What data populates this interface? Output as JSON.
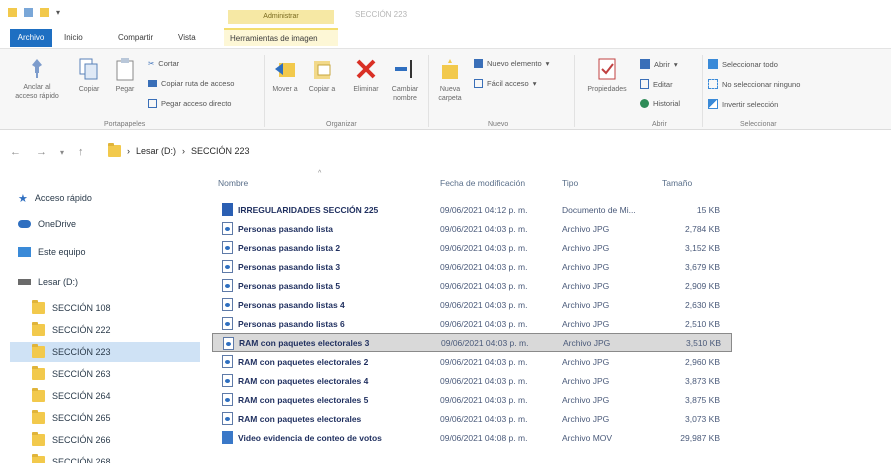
{
  "window": {
    "context_header": "Administrar",
    "title": "SECCIÓN 223"
  },
  "tabs": [
    {
      "label": "Archivo"
    },
    {
      "label": "Inicio"
    },
    {
      "label": "Compartir"
    },
    {
      "label": "Vista"
    },
    {
      "label": "Herramientas de imagen"
    }
  ],
  "ribbon": {
    "portapapeles": {
      "anclar": "Anclar al acceso rápido",
      "copiar": "Copiar",
      "pegar": "Pegar",
      "cortar": "Cortar",
      "copiar_ruta": "Copiar ruta de acceso",
      "pegar_acceso": "Pegar acceso directo",
      "label": "Portapapeles"
    },
    "organizar": {
      "mover": "Mover a",
      "copiar": "Copiar a",
      "eliminar": "Eliminar",
      "cambiar": "Cambiar nombre",
      "label": "Organizar"
    },
    "nuevo": {
      "carpeta": "Nueva carpeta",
      "elemento": "Nuevo elemento",
      "facil": "Fácil acceso",
      "label": "Nuevo"
    },
    "abrir": {
      "propiedades": "Propiedades",
      "abrir": "Abrir",
      "editar": "Editar",
      "historial": "Historial",
      "label": "Abrir"
    },
    "seleccionar": {
      "todo": "Seleccionar todo",
      "ninguno": "No seleccionar ninguno",
      "invertir": "Invertir selección",
      "label": "Seleccionar"
    }
  },
  "address": {
    "drive": "Lesar (D:)",
    "folder": "SECCIÓN 223"
  },
  "sidebar": {
    "quick_access": "Acceso rápido",
    "onedrive": "OneDrive",
    "this_pc": "Este equipo",
    "drive": "Lesar (D:)",
    "folders": [
      "SECCIÓN 108",
      "SECCIÓN 222",
      "SECCIÓN 223",
      "SECCIÓN 263",
      "SECCIÓN 264",
      "SECCIÓN 265",
      "SECCIÓN 266",
      "SECCIÓN 268"
    ],
    "selected_index": 2
  },
  "columns": {
    "name": "Nombre",
    "date": "Fecha de modificación",
    "type": "Tipo",
    "size": "Tamaño"
  },
  "files": [
    {
      "name": "IRREGULARIDADES SECCIÓN 225",
      "date": "09/06/2021 04:12 p. m.",
      "type": "Documento de Mi...",
      "size": "15 KB",
      "icon": "doc"
    },
    {
      "name": "Personas pasando lista",
      "date": "09/06/2021 04:03 p. m.",
      "type": "Archivo JPG",
      "size": "2,784 KB",
      "icon": "jpg"
    },
    {
      "name": "Personas pasando lista 2",
      "date": "09/06/2021 04:03 p. m.",
      "type": "Archivo JPG",
      "size": "3,152 KB",
      "icon": "jpg"
    },
    {
      "name": "Personas pasando lista 3",
      "date": "09/06/2021 04:03 p. m.",
      "type": "Archivo JPG",
      "size": "3,679 KB",
      "icon": "jpg"
    },
    {
      "name": "Personas pasando lista 5",
      "date": "09/06/2021 04:03 p. m.",
      "type": "Archivo JPG",
      "size": "2,909 KB",
      "icon": "jpg"
    },
    {
      "name": "Personas pasando listas 4",
      "date": "09/06/2021 04:03 p. m.",
      "type": "Archivo JPG",
      "size": "2,630 KB",
      "icon": "jpg"
    },
    {
      "name": "Personas pasando listas 6",
      "date": "09/06/2021 04:03 p. m.",
      "type": "Archivo JPG",
      "size": "2,510 KB",
      "icon": "jpg"
    },
    {
      "name": "RAM con paquetes electorales 3",
      "date": "09/06/2021 04:03 p. m.",
      "type": "Archivo JPG",
      "size": "3,510 KB",
      "icon": "jpg"
    },
    {
      "name": "RAM con paquetes electorales 2",
      "date": "09/06/2021 04:03 p. m.",
      "type": "Archivo JPG",
      "size": "2,960 KB",
      "icon": "jpg"
    },
    {
      "name": "RAM con paquetes electorales 4",
      "date": "09/06/2021 04:03 p. m.",
      "type": "Archivo JPG",
      "size": "3,873 KB",
      "icon": "jpg"
    },
    {
      "name": "RAM con paquetes electorales 5",
      "date": "09/06/2021 04:03 p. m.",
      "type": "Archivo JPG",
      "size": "3,875 KB",
      "icon": "jpg"
    },
    {
      "name": "RAM con paquetes electorales",
      "date": "09/06/2021 04:03 p. m.",
      "type": "Archivo JPG",
      "size": "3,073 KB",
      "icon": "jpg"
    },
    {
      "name": "Video evidencia de conteo de votos",
      "date": "09/06/2021 04:08 p. m.",
      "type": "Archivo MOV",
      "size": "29,987 KB",
      "icon": "mov"
    }
  ],
  "selected_file_index": 7,
  "colors": {
    "accent": "#1e6fc2",
    "context_tab": "#f6e8a4",
    "folder": "#f2c94c",
    "delete": "#d93025"
  }
}
